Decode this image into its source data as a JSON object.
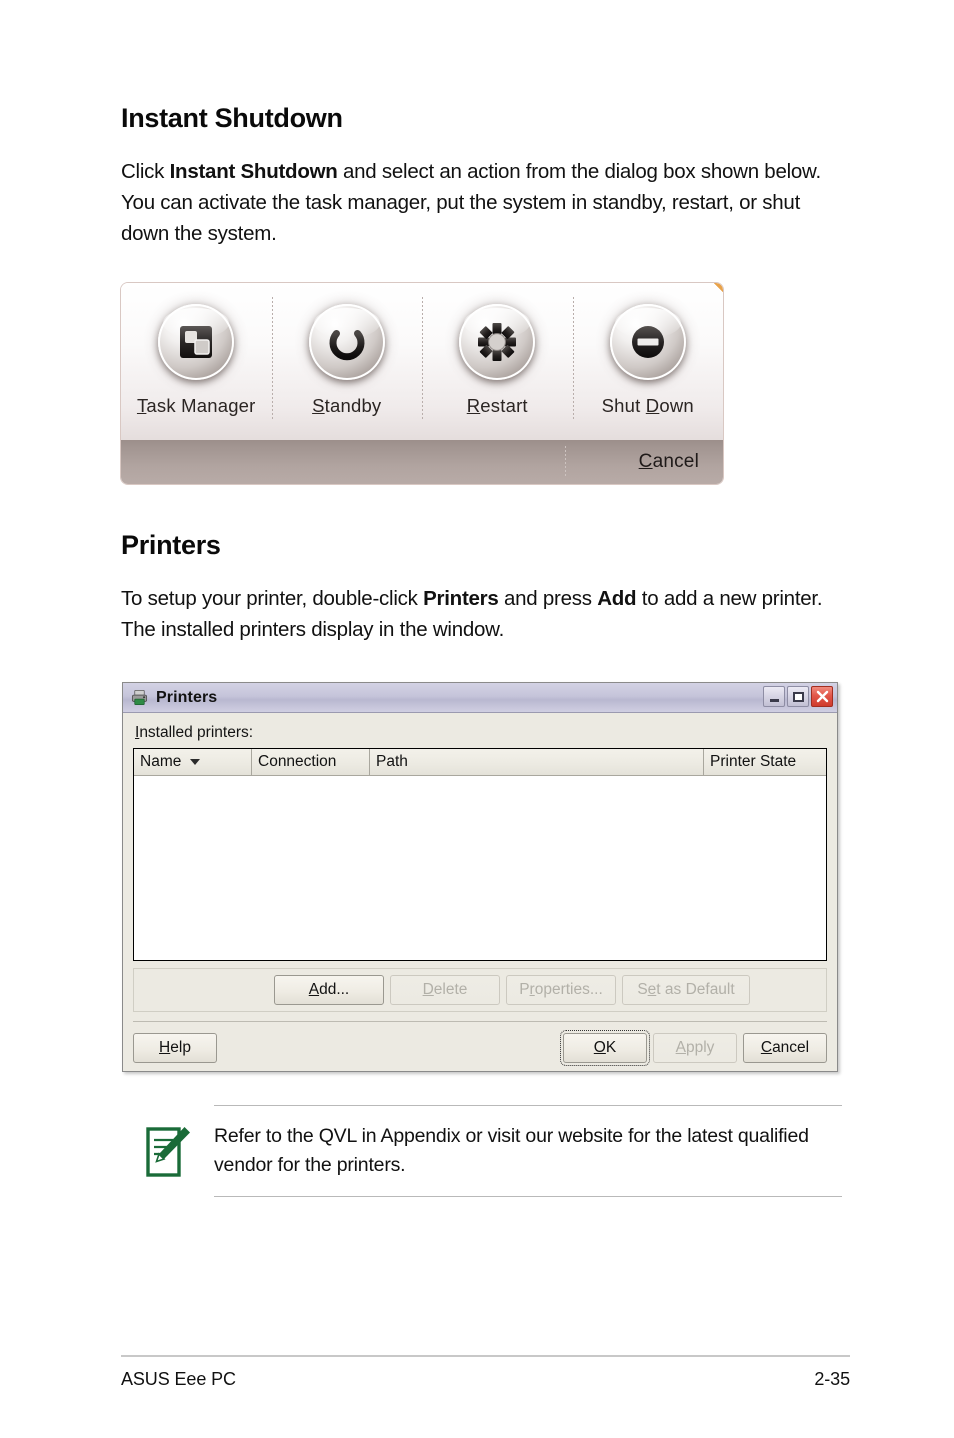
{
  "document": {
    "sections": [
      {
        "heading": "Instant Shutdown",
        "paragraph_parts": [
          {
            "text": "Click ",
            "bold": false
          },
          {
            "text": "Instant Shutdown",
            "bold": true
          },
          {
            "text": " and select an action from the dialog box shown below. You can activate the task manager, put the system in standby, restart, or shut down the system.",
            "bold": false
          }
        ]
      },
      {
        "heading": "Printers",
        "paragraph_parts": [
          {
            "text": "To setup your printer, double-click ",
            "bold": false
          },
          {
            "text": "Printers",
            "bold": true
          },
          {
            "text": " and press ",
            "bold": false
          },
          {
            "text": "Add",
            "bold": true
          },
          {
            "text": " to add a new printer. The installed printers display in the window.",
            "bold": false
          }
        ]
      }
    ]
  },
  "shutdown_dialog": {
    "items": [
      {
        "label_prefix": "",
        "accel": "T",
        "label_suffix": "ask Manager",
        "icon": "task-manager-icon"
      },
      {
        "label_prefix": "",
        "accel": "S",
        "label_suffix": "tandby",
        "icon": "power-standby-icon"
      },
      {
        "label_prefix": "",
        "accel": "R",
        "label_suffix": "estart",
        "icon": "restart-gear-icon"
      },
      {
        "label_prefix": "Shut ",
        "accel": "D",
        "label_suffix": "own",
        "icon": "shut-down-icon"
      }
    ],
    "cancel": {
      "label_prefix": "",
      "accel": "C",
      "label_suffix": "ancel"
    }
  },
  "printers_window": {
    "title": "Printers",
    "title_icon": "printer-icon",
    "window_controls": {
      "minimize": "minimize-icon",
      "maximize": "maximize-icon",
      "close": "close-icon"
    },
    "list_label": {
      "accel": "I",
      "rest": "nstalled printers:"
    },
    "columns": [
      {
        "label": "Name",
        "sorted": true
      },
      {
        "label": "Connection",
        "sorted": false
      },
      {
        "label": "Path",
        "sorted": false
      },
      {
        "label": "Printer State",
        "sorted": false
      }
    ],
    "rows": [],
    "action_buttons": [
      {
        "prefix": "",
        "accel": "A",
        "suffix": "dd...",
        "enabled": true
      },
      {
        "prefix": "",
        "accel": "D",
        "suffix": "elete",
        "enabled": false
      },
      {
        "prefix": "P",
        "accel": "r",
        "suffix": "operties...",
        "enabled": false
      },
      {
        "prefix": "S",
        "accel": "e",
        "suffix": "t as Default",
        "enabled": false
      }
    ],
    "dialog_buttons": {
      "help": {
        "prefix": "",
        "accel": "H",
        "suffix": "elp",
        "enabled": true
      },
      "ok": {
        "prefix": "",
        "accel": "O",
        "suffix": "K",
        "enabled": true,
        "focused": true
      },
      "apply": {
        "prefix": "",
        "accel": "A",
        "suffix": "pply",
        "enabled": false
      },
      "cancel": {
        "prefix": "",
        "accel": "C",
        "suffix": "ancel",
        "enabled": true
      }
    }
  },
  "note": {
    "icon": "note-pencil-icon",
    "text": "Refer to the QVL in Appendix or visit our website for the latest qualified vendor for the printers.",
    "accent_color": "#1a6b38"
  },
  "page_footer": {
    "left": "ASUS Eee PC",
    "right": "2-35"
  }
}
